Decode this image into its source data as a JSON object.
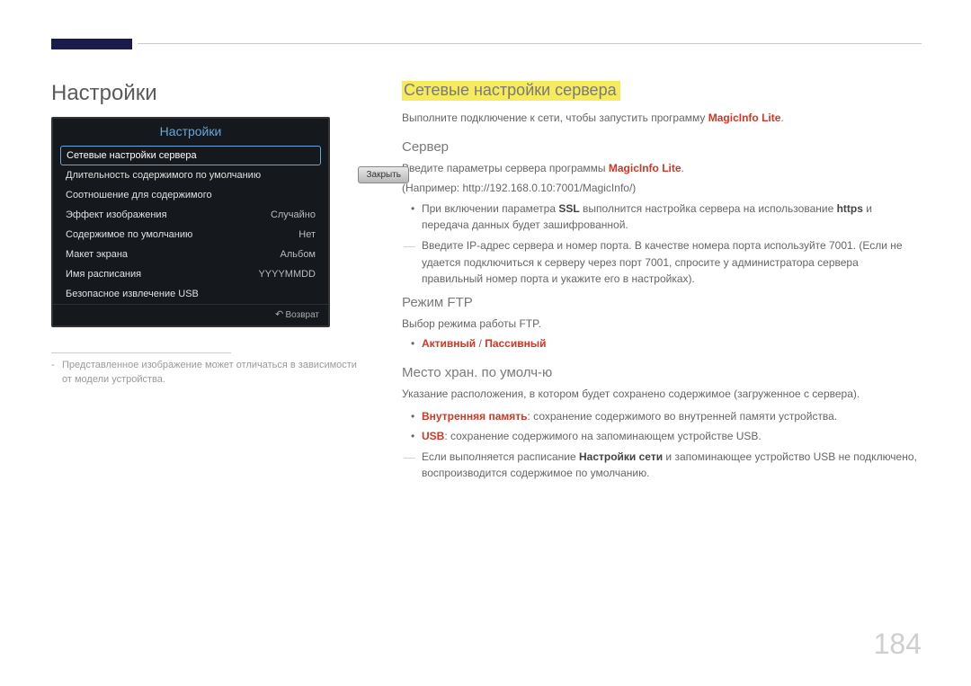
{
  "page_number": "184",
  "left": {
    "heading": "Настройки",
    "osd": {
      "title": "Настройки",
      "rows": [
        {
          "label": "Сетевые настройки сервера",
          "value": "",
          "selected": true
        },
        {
          "label": "Длительность содержимого по умолчанию",
          "value": ""
        },
        {
          "label": "Соотношение для содержимого",
          "value": ""
        },
        {
          "label": "Эффект изображения",
          "value": "Случайно"
        },
        {
          "label": "Содержимое по умолчанию",
          "value": "Нет"
        },
        {
          "label": "Макет экрана",
          "value": "Альбом"
        },
        {
          "label": "Имя расписания",
          "value": "YYYYMMDD"
        },
        {
          "label": "Безопасное извлечение USB",
          "value": ""
        }
      ],
      "close": "Закрыть",
      "return": "Возврат"
    },
    "footnote": "Представленное изображение может отличаться в зависимости от модели устройства."
  },
  "right": {
    "heading": "Сетевые настройки сервера",
    "intro_pre": "Выполните подключение к сети, чтобы запустить программу ",
    "intro_em": "MagicInfo Lite",
    "intro_post": ".",
    "server": {
      "heading": "Сервер",
      "line1_pre": "Введите параметры сервера программы ",
      "line1_em": "MagicInfo Lite",
      "line1_post": ".",
      "example": "(Например: http://192.168.0.10:7001/MagicInfo/)",
      "bullet1_pre": "При включении параметра ",
      "bullet1_ssl": "SSL",
      "bullet1_mid": " выполнится настройка сервера на использование ",
      "bullet1_https": "https",
      "bullet1_post": " и передача данных будет зашифрованной.",
      "dash": "Введите IP-адрес сервера и номер порта. В качестве номера порта используйте 7001. (Если не удается подключиться к серверу через порт 7001, спросите у администратора сервера правильный номер порта и укажите его в настройках)."
    },
    "ftp": {
      "heading": "Режим FTP",
      "line": "Выбор режима работы FTP.",
      "opt_active": "Активный",
      "opt_sep": " / ",
      "opt_passive": "Пассивный"
    },
    "storage": {
      "heading": "Место хран. по умолч-ю",
      "line": "Указание расположения, в котором будет сохранено содержимое (загруженное с сервера).",
      "b1_label": "Внутренняя память",
      "b1_text": ": сохранение содержимого во внутренней памяти устройства.",
      "b2_label": "USB",
      "b2_text": ": сохранение содержимого на запоминающем устройстве USB.",
      "dash_pre": "Если выполняется расписание ",
      "dash_em": "Настройки сети",
      "dash_post": " и запоминающее устройство USB не подключено, воспроизводится содержимое по умолчанию."
    }
  }
}
